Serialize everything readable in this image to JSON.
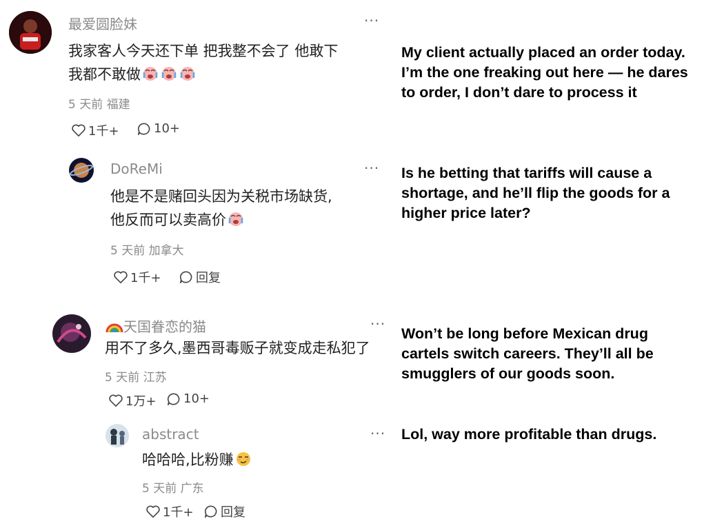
{
  "comments": [
    {
      "username": "最爱圆脸妹",
      "text_line1": "我家客人今天还下单 把我整不会了 他敢下",
      "text_line2": "我都不敢做",
      "meta": "5 天前 福建",
      "likes": "1千+",
      "replies": "10+",
      "translation": "My client actually placed an order today. I’m the one freaking out here — he dares to order, I don’t dare to process it"
    },
    {
      "username": "DoReMi",
      "text_line1": "他是不是赌回头因为关税市场缺货,",
      "text_line2": "他反而可以卖高价",
      "meta": "5 天前 加拿大",
      "likes": "1千+",
      "reply_label": "回复",
      "translation": "Is he betting that tariffs will cause a shortage, and he’ll flip the goods for a higher price later?"
    },
    {
      "username": "天国眷恋的猫",
      "text_line1": "用不了多久,墨西哥毒贩子就变成走私犯了",
      "meta": "5 天前 江苏",
      "likes": "1万+",
      "replies": "10+",
      "translation": "Won’t be long before Mexican drug cartels switch careers. They’ll all be smugglers of our goods soon."
    },
    {
      "username": "abstract",
      "text_line1": "哈哈哈,比粉赚",
      "meta": "5 天前 广东",
      "likes": "1千+",
      "reply_label": "回复",
      "translation": "Lol, way more profitable than drugs."
    }
  ],
  "more_label": "···",
  "colors": {
    "meta": "#8a8a8a",
    "text": "#222222",
    "translation": "#000000"
  },
  "icons": [
    "heart-icon",
    "comment-icon",
    "crying-emoji-icon",
    "smirk-emoji-icon",
    "rainbow-icon"
  ]
}
